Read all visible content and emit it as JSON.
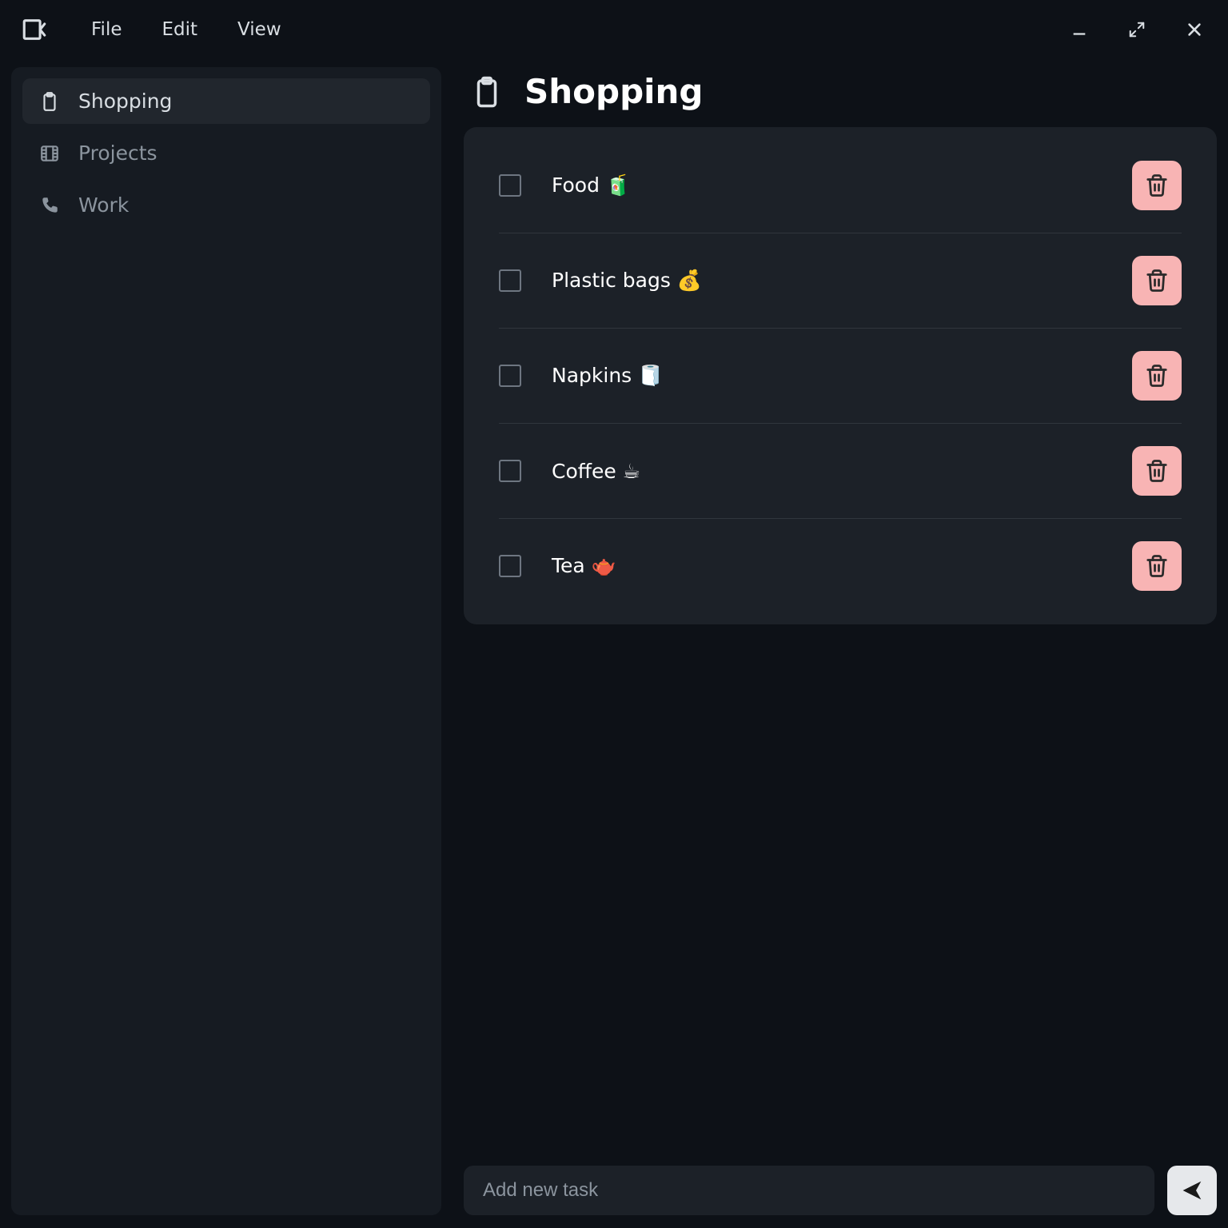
{
  "menubar": {
    "items": [
      "File",
      "Edit",
      "View"
    ]
  },
  "sidebar": {
    "items": [
      {
        "icon": "clipboard",
        "label": "Shopping",
        "active": true
      },
      {
        "icon": "film",
        "label": "Projects",
        "active": false
      },
      {
        "icon": "phone",
        "label": "Work",
        "active": false
      }
    ]
  },
  "main": {
    "title": "Shopping",
    "title_icon": "clipboard",
    "tasks": [
      {
        "label": "Food 🧃",
        "checked": false
      },
      {
        "label": "Plastic bags 💰",
        "checked": false
      },
      {
        "label": "Napkins 🧻",
        "checked": false
      },
      {
        "label": "Coffee ☕",
        "checked": false
      },
      {
        "label": "Tea 🫖",
        "checked": false
      }
    ],
    "input_placeholder": "Add new task"
  },
  "colors": {
    "accent": "#f8b4b4",
    "bg": "#0d1117",
    "panel": "#161b22"
  }
}
